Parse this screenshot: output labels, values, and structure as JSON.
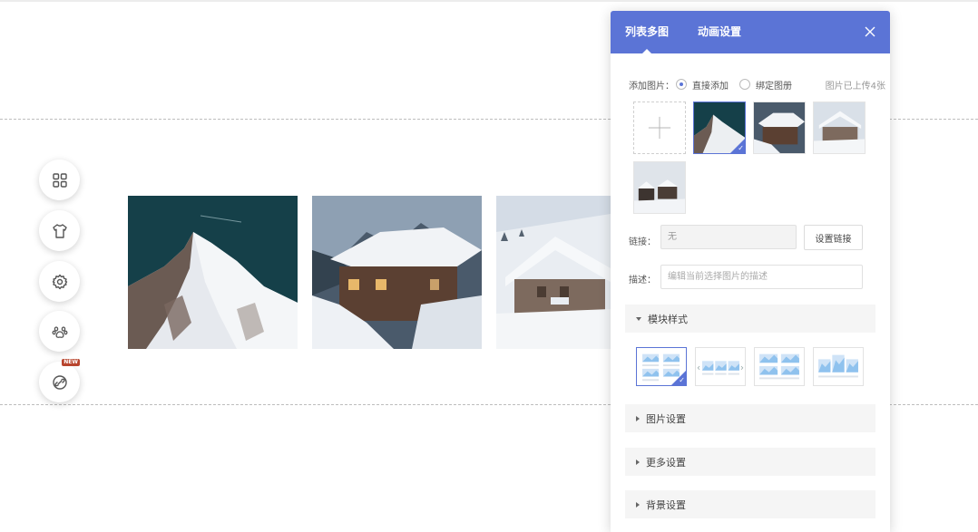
{
  "panel": {
    "tabs": [
      {
        "label": "列表多图",
        "active": true
      },
      {
        "label": "动画设置",
        "active": false
      }
    ],
    "add_image": {
      "label": "添加图片：",
      "options": [
        {
          "label": "直接添加",
          "selected": true
        },
        {
          "label": "绑定图册",
          "selected": false
        }
      ],
      "upload_count": "图片已上传4张"
    },
    "link": {
      "label": "链接：",
      "value": "无",
      "button": "设置链接"
    },
    "description": {
      "label": "描述：",
      "placeholder": "编辑当前选择图片的描述"
    },
    "sections": {
      "module_style": "模块样式",
      "image_settings": "图片设置",
      "more_settings": "更多设置",
      "background_settings": "背景设置"
    }
  },
  "side_tools": [
    {
      "icon": "grid-icon"
    },
    {
      "icon": "shirt-icon"
    },
    {
      "icon": "gear-icon"
    },
    {
      "icon": "paw-icon"
    },
    {
      "icon": "link-icon",
      "badge": "NEW"
    }
  ],
  "colors": {
    "accent": "#5b74d6",
    "badge": "#b8452e"
  }
}
